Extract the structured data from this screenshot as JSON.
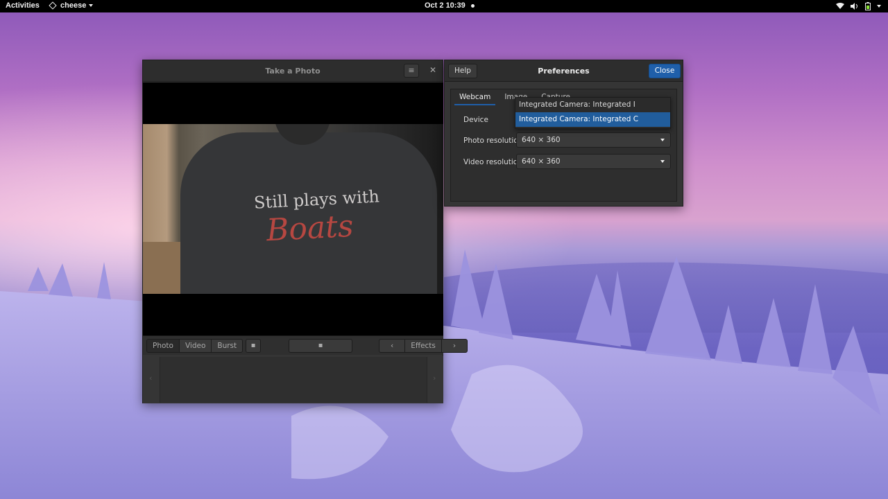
{
  "topbar": {
    "activities": "Activities",
    "app_name": "cheese",
    "clock": "Oct 2  10:39"
  },
  "cheese_window": {
    "title": "Take a Photo",
    "modes": [
      "Photo",
      "Video",
      "Burst"
    ],
    "active_mode": "Photo",
    "effects_label": "Effects",
    "shirt_text_line1": "Still plays with",
    "shirt_text_line2": "Boats"
  },
  "preferences": {
    "help_label": "Help",
    "title": "Preferences",
    "close_label": "Close",
    "tabs": [
      "Webcam",
      "Image",
      "Capture"
    ],
    "active_tab": "Webcam",
    "device_label": "Device",
    "photo_resolution_label": "Photo resolution",
    "photo_resolution_value": "640 × 360",
    "video_resolution_label": "Video resolution",
    "video_resolution_value": "640 × 360",
    "device_options": [
      "Integrated Camera: Integrated I",
      "Integrated Camera: Integrated C"
    ],
    "selected_device_index": 1
  },
  "colors": {
    "accent": "#1f5faa",
    "selection": "#215d9c",
    "topbar_bg": "#000000",
    "window_bg": "#353535"
  },
  "icons": [
    "menu-icon",
    "close-icon",
    "wifi-icon",
    "volume-icon",
    "battery-icon",
    "power-menu-icon",
    "camera-switch-icon",
    "shutter-icon",
    "chevron-left-icon",
    "chevron-right-icon",
    "dropdown-arrow-icon"
  ]
}
